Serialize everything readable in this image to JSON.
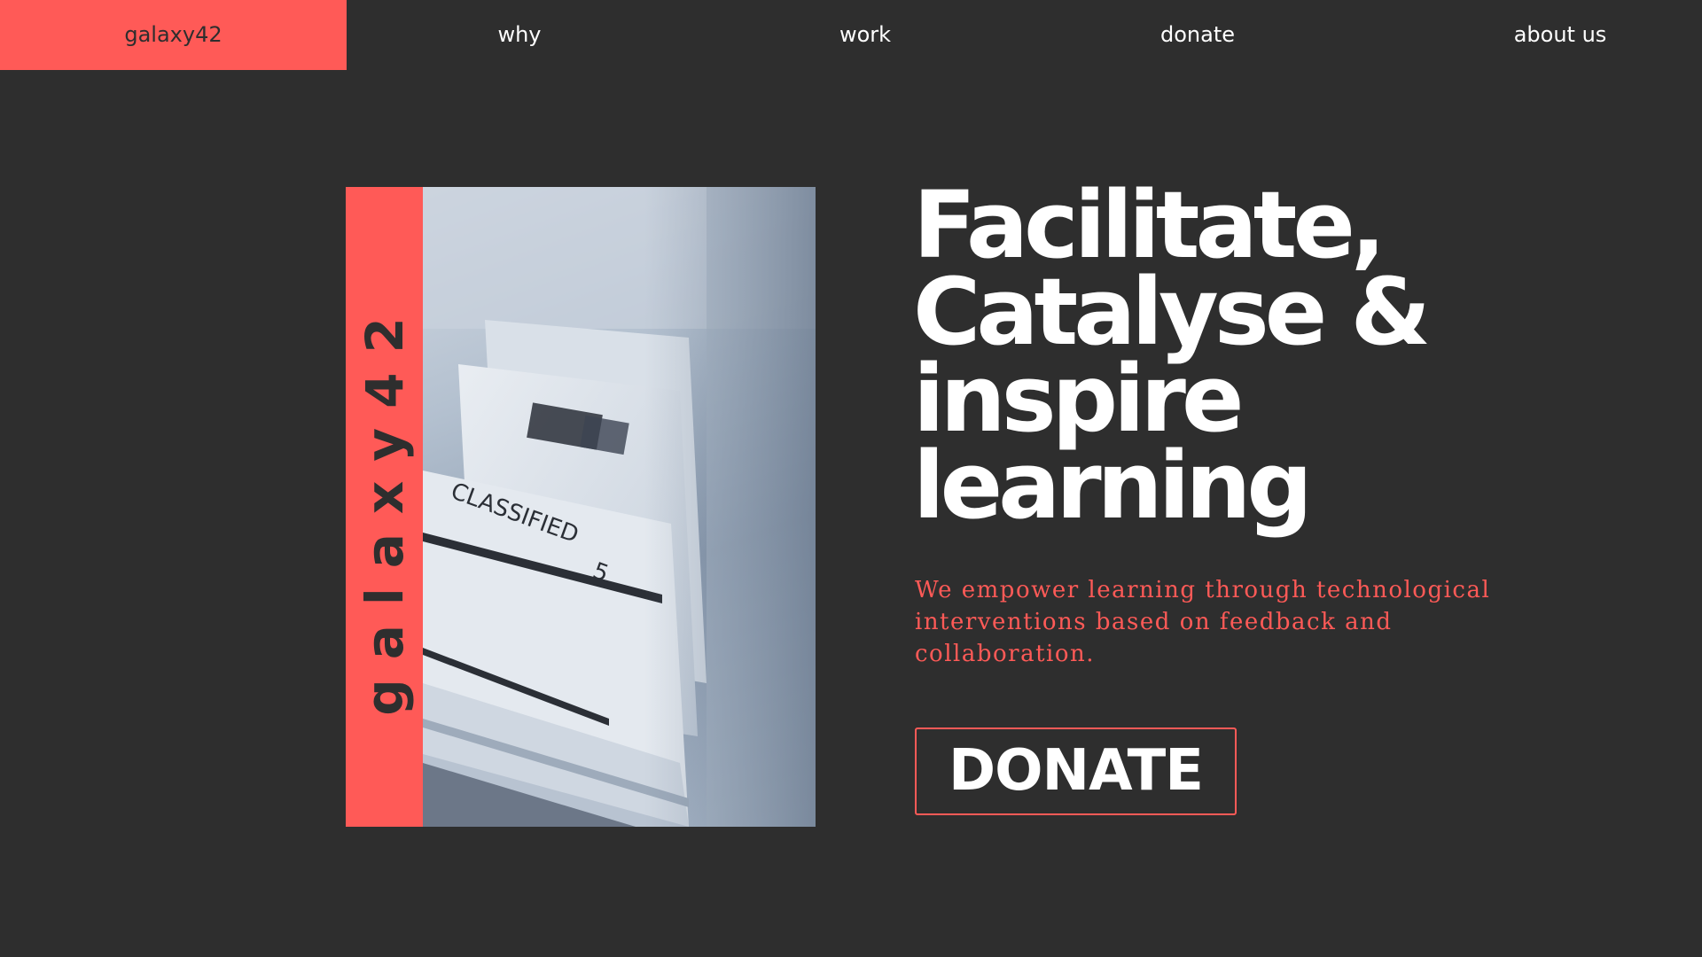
{
  "nav": {
    "brand": "galaxy42",
    "items": [
      {
        "label": "why"
      },
      {
        "label": "work"
      },
      {
        "label": "donate"
      },
      {
        "label": "about us"
      }
    ]
  },
  "hero": {
    "side_label": "galaxy42",
    "image": {
      "printed_text": [
        "CLASSIFIED",
        "5"
      ]
    },
    "headline_lines": [
      "Facilitate,",
      "Catalyse &",
      "inspire",
      "learning"
    ],
    "subtext": "We empower learning through technological interventions based on feedback and collaboration.",
    "cta_label": "DONATE"
  },
  "colors": {
    "background": "#2e2e2e",
    "accent": "#ff5a57",
    "text": "#ffffff"
  }
}
